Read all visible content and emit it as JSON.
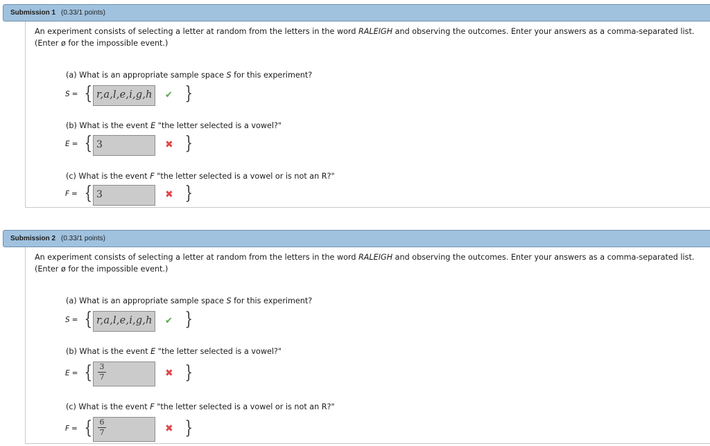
{
  "colors": {
    "header_bg": "#a0c2df",
    "correct": "#58a84c",
    "incorrect": "#e0474c",
    "answer_box_bg": "#cbcbcb"
  },
  "submissions": [
    {
      "title": "Submission 1",
      "points": "(0.33/1 points)",
      "intro": {
        "pre": "An experiment consists of selecting a letter at random from the letters in the word ",
        "word": "RALEIGH",
        "post": " and observing the outcomes. Enter your answers as a comma-separated list.",
        "line2": "(Enter ø for the impossible event.)"
      },
      "parts": [
        {
          "question_pre": "(a) What is an appropriate sample space ",
          "question_var": "S",
          "question_post": " for this experiment?",
          "var": "S",
          "eq": "=",
          "answer": "r,a,l,e,i,g,h",
          "status": "correct",
          "status_icon": "checkmark-icon"
        },
        {
          "question_pre": "(b) What is the event ",
          "question_var": "E",
          "question_post": " \"the letter selected is a vowel?\"",
          "var": "E",
          "eq": "=",
          "answer": "3",
          "status": "incorrect",
          "status_icon": "cross-icon"
        },
        {
          "question_pre": "(c) What is the event ",
          "question_var": "F",
          "question_post": " \"the letter selected is a vowel or is not an R?\"",
          "var": "F",
          "eq": "=",
          "answer": "3",
          "status": "incorrect",
          "status_icon": "cross-icon"
        }
      ]
    },
    {
      "title": "Submission 2",
      "points": "(0.33/1 points)",
      "intro": {
        "pre": "An experiment consists of selecting a letter at random from the letters in the word ",
        "word": "RALEIGH",
        "post": " and observing the outcomes. Enter your answers as a comma-separated list.",
        "line2": "(Enter ø for the impossible event.)"
      },
      "parts": [
        {
          "question_pre": "(a) What is an appropriate sample space ",
          "question_var": "S",
          "question_post": " for this experiment?",
          "var": "S",
          "eq": "=",
          "answer": "r,a,l,e,i,g,h",
          "status": "correct",
          "status_icon": "checkmark-icon"
        },
        {
          "question_pre": "(b) What is the event ",
          "question_var": "E",
          "question_post": " \"the letter selected is a vowel?\"",
          "var": "E",
          "eq": "=",
          "answer_num": "3",
          "answer_den": "7",
          "status": "incorrect",
          "status_icon": "cross-icon"
        },
        {
          "question_pre": "(c) What is the event ",
          "question_var": "F",
          "question_post": " \"the letter selected is a vowel or is not an R?\"",
          "var": "F",
          "eq": "=",
          "answer_num": "6",
          "answer_den": "7",
          "status": "incorrect",
          "status_icon": "cross-icon"
        }
      ]
    }
  ],
  "glyphs": {
    "brace_open": "{",
    "brace_close": "}",
    "check": "✔",
    "cross": "✖"
  }
}
